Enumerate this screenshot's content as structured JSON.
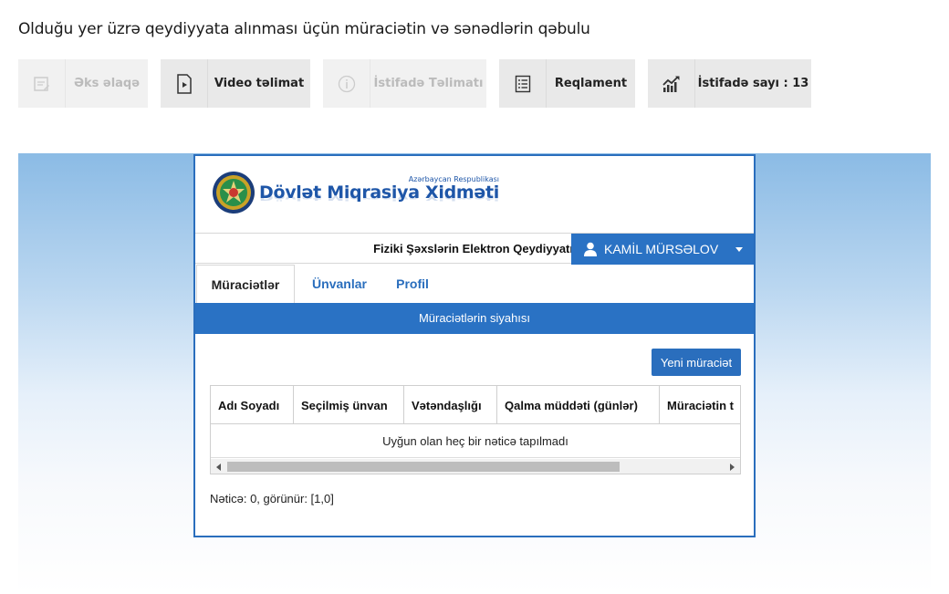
{
  "page": {
    "title": "Olduğu yer üzrə qeydiyyata alınması üçün müraciətin və sənədlərin qəbulu"
  },
  "toolbar": {
    "feedback": "Əks əlaqə",
    "video": "Video təlimat",
    "usage_guide": "İstifadə Təlimatı",
    "regulation": "Reqlament",
    "usage_count": "İstifadə sayı : 13"
  },
  "app": {
    "logo": {
      "top": "Azərbaycan Respublikası",
      "name": "Dövlət Miqrasiya Xidməti"
    },
    "system_title": "Fiziki Şəxslərin Elektron Qeydiyyatı",
    "user": {
      "name": "KAMİL MÜRSƏLOV",
      "icon": "user-icon"
    },
    "tabs": [
      "Müraciətlər",
      "Ünvanlar",
      "Profil"
    ],
    "active_tab": "Müraciətlər",
    "band_title": "Müraciətlərin siyahısı",
    "new_button": "Yeni müraciət",
    "table": {
      "columns": [
        "Adı Soyadı",
        "Seçilmiş ünvan",
        "Vətəndaşlığı",
        "Qalma müddəti (günlər)",
        "Müraciətin t"
      ],
      "empty_text": "Uyğun olan heç bir nəticə tapılmadı"
    },
    "result_text": "Nəticə: 0, görünür: [1,0]"
  },
  "colors": {
    "accent": "#2a72c4",
    "frame_gradient_top": "#8bbbe5"
  }
}
